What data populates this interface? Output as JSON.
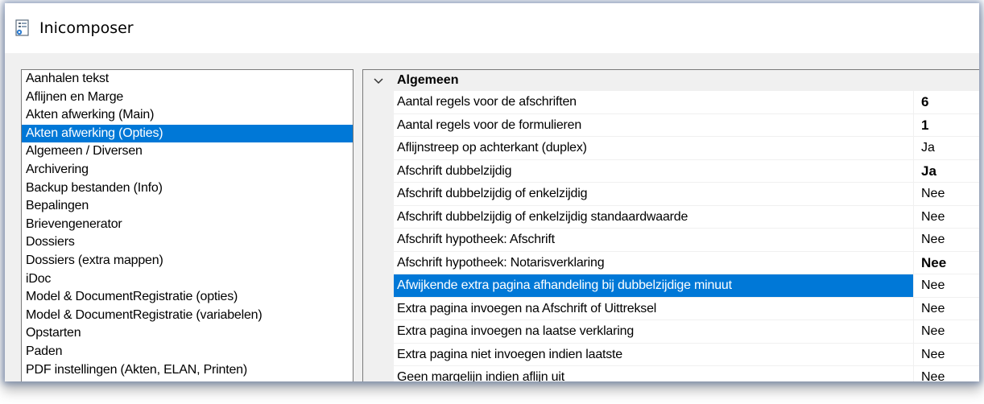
{
  "window": {
    "title": "Inicomposer",
    "icon": "settings-document-icon"
  },
  "sidebar": {
    "items": [
      {
        "label": "Aanhalen tekst",
        "selected": false
      },
      {
        "label": "Aflijnen en Marge",
        "selected": false
      },
      {
        "label": "Akten afwerking (Main)",
        "selected": false
      },
      {
        "label": "Akten afwerking (Opties)",
        "selected": true
      },
      {
        "label": "Algemeen / Diversen",
        "selected": false
      },
      {
        "label": "Archivering",
        "selected": false
      },
      {
        "label": "Backup bestanden (Info)",
        "selected": false
      },
      {
        "label": "Bepalingen",
        "selected": false
      },
      {
        "label": "Brievengenerator",
        "selected": false
      },
      {
        "label": "Dossiers",
        "selected": false
      },
      {
        "label": "Dossiers (extra mappen)",
        "selected": false
      },
      {
        "label": "iDoc",
        "selected": false
      },
      {
        "label": "Model & DocumentRegistratie (opties)",
        "selected": false
      },
      {
        "label": "Model & DocumentRegistratie (variabelen)",
        "selected": false
      },
      {
        "label": "Opstarten",
        "selected": false
      },
      {
        "label": "Paden",
        "selected": false
      },
      {
        "label": "PDF instellingen (Akten, ELAN, Printen)",
        "selected": false
      }
    ]
  },
  "grid": {
    "category": {
      "label": "Algemeen",
      "icon": "chevron-down-icon",
      "expanded": true
    },
    "properties": [
      {
        "name": "Aantal regels voor de afschriften",
        "value": "6",
        "bold": true,
        "selected": false
      },
      {
        "name": "Aantal regels voor de formulieren",
        "value": "1",
        "bold": true,
        "selected": false
      },
      {
        "name": "Aflijnstreep op achterkant (duplex)",
        "value": "Ja",
        "bold": false,
        "selected": false
      },
      {
        "name": "Afschrift dubbelzijdig",
        "value": "Ja",
        "bold": true,
        "selected": false
      },
      {
        "name": "Afschrift dubbelzijdig of enkelzijdig",
        "value": "Nee",
        "bold": false,
        "selected": false
      },
      {
        "name": "Afschrift dubbelzijdig of enkelzijdig standaardwaarde",
        "value": "Nee",
        "bold": false,
        "selected": false
      },
      {
        "name": "Afschrift hypotheek: Afschrift",
        "value": "Nee",
        "bold": false,
        "selected": false
      },
      {
        "name": "Afschrift hypotheek: Notarisverklaring",
        "value": "Nee",
        "bold": true,
        "selected": false
      },
      {
        "name": "Afwijkende extra pagina afhandeling bij dubbelzijdige minuut",
        "value": "Nee",
        "bold": false,
        "selected": true
      },
      {
        "name": "Extra pagina invoegen na Afschrift of Uittreksel",
        "value": "Nee",
        "bold": false,
        "selected": false
      },
      {
        "name": "Extra pagina invoegen na laatse verklaring",
        "value": "Nee",
        "bold": false,
        "selected": false
      },
      {
        "name": "Extra pagina niet invoegen indien laatste",
        "value": "Nee",
        "bold": false,
        "selected": false
      },
      {
        "name": "Geen margelijn indien aflijn uit",
        "value": "Nee",
        "bold": false,
        "selected": false
      }
    ]
  },
  "colors": {
    "selection": "#0078d7",
    "background": "#f0f0f0"
  }
}
